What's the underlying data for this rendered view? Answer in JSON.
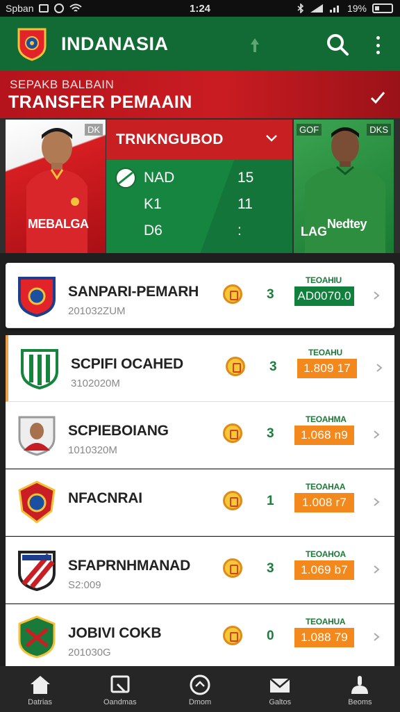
{
  "status_bar": {
    "carrier": "Spban",
    "time": "1:24",
    "battery": "19%"
  },
  "app_bar": {
    "title": "INDANASIA"
  },
  "banner": {
    "subtitle": "SEPAKB BALBAIN",
    "title": "TRANSFER PEMAAIN"
  },
  "hero": {
    "left_player": {
      "tag": "DK",
      "jersey_text": "MEBALGA"
    },
    "right_player": {
      "tag_left": "GOF",
      "tag_right": "DKS",
      "jersey_text": "Nedtey",
      "name": "LAG"
    },
    "stats": {
      "header": "TRNKNGUBOD",
      "rows": [
        {
          "key": "NAD",
          "value": "15"
        },
        {
          "key": "K1",
          "value": "11"
        },
        {
          "key": "D6",
          "value": ":"
        }
      ]
    }
  },
  "transfers": [
    {
      "club": "SANPARI-PEMARH",
      "date": "201032ZUM",
      "count": "3",
      "price_label": "TEOAHIU",
      "price": "AD0070.0",
      "price_style": "green"
    },
    {
      "club": "SCPIFI OCAHED",
      "date": "3102020M",
      "count": "3",
      "price_label": "TEOAHU",
      "price": "1.809 17",
      "price_style": "orange"
    },
    {
      "club": "SCPIEBOIANG",
      "date": "1010320M",
      "count": "3",
      "price_label": "TEOAHMA",
      "price": "1.068 n9",
      "price_style": "orange"
    },
    {
      "club": "NFACNRAI",
      "date": "",
      "count": "1",
      "price_label": "TEOAHAA",
      "price": "1.008 r7",
      "price_style": "orange"
    },
    {
      "club": "SFAPRNHMANAD",
      "date": "S2:009",
      "count": "3",
      "price_label": "TEOAHOA",
      "price": "1.069 b7",
      "price_style": "orange"
    },
    {
      "club": "JOBIVI COKB",
      "date": "201030G",
      "count": "0",
      "price_label": "TEOAHUA",
      "price": "1.088 79",
      "price_style": "orange"
    }
  ],
  "bottom_nav": [
    {
      "label": "Datrias",
      "icon": "home-icon"
    },
    {
      "label": "Oandmas",
      "icon": "transfer-icon"
    },
    {
      "label": "Dmom",
      "icon": "ball-icon"
    },
    {
      "label": "Galtos",
      "icon": "mail-icon"
    },
    {
      "label": "Beoms",
      "icon": "profile-icon"
    }
  ],
  "colors": {
    "primary_green": "#126b34",
    "accent_red": "#c71f22",
    "price_orange": "#f3891d"
  }
}
